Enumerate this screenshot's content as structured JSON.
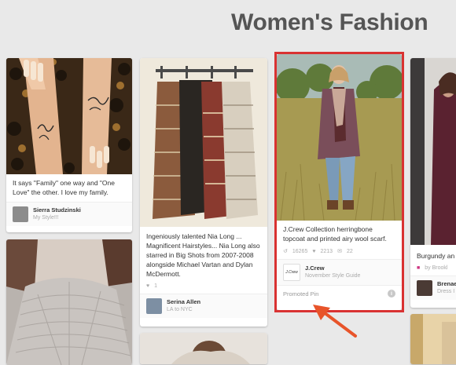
{
  "board": {
    "title": "Women's Fashion"
  },
  "pins": [
    {
      "id": "tattoo",
      "description": "It says \"Family\" one way and \"One Love\" the other. I love my family.",
      "pinner": "Sierra Studzinski",
      "board": "My Style!!!"
    },
    {
      "id": "sweaters",
      "description": "Ingeniously talented Nia Long ... Magnificent Hairstyles... Nia Long also starred in Big Shots from 2007-2008 alongside Michael Vartan and Dylan McDermott.",
      "likes": "1",
      "pinner": "Serina Allen",
      "board": "LA to NYC"
    },
    {
      "id": "jcrew",
      "description": "J.Crew Collection herringbone topcoat and printed airy wool scarf.",
      "repins": "16265",
      "likes": "2213",
      "comments": "22",
      "pinner": "J.Crew",
      "avatar_text": "J.Crew",
      "board": "November Style Guide",
      "promoted_label": "Promoted Pin",
      "info_icon": "i"
    },
    {
      "id": "burgundy",
      "description": "Burgundy an",
      "source": "by Brookl",
      "pinner": "Brenae",
      "board": "Dress I"
    }
  ],
  "colors": {
    "highlight": "#d93232",
    "arrow": "#e8542a",
    "background": "#e9e9e9"
  },
  "icons": [
    "repin-icon",
    "heart-icon",
    "comment-icon",
    "info-icon",
    "arrow-pointer",
    "source-icon"
  ]
}
